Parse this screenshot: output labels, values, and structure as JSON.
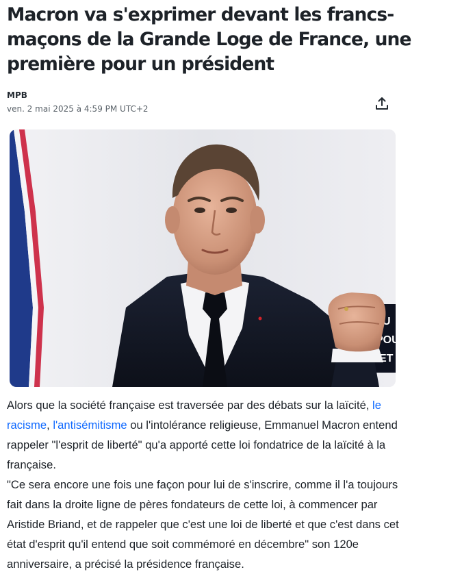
{
  "article": {
    "title": "Macron va s'exprimer devant les francs-maçons de la Grande Loge de France, une première pour un président",
    "author": "MPB",
    "timestamp": "ven. 2 mai 2025 à 4:59 PM UTC+2",
    "share_icon": "share-upload-icon",
    "image": {
      "subject": "photo-of-speaker-raising-fist",
      "backdrop_letters": [
        "U",
        "POU",
        "ET"
      ]
    },
    "paragraph1": {
      "before": "Alors que la société française est traversée par des débats sur la laïcité, ",
      "link1": "le racisme",
      "sep": ", ",
      "link2": "l'antisémitisme",
      "after": " ou l'intolérance religieuse, Emmanuel Macron entend rappeler \"l'esprit de liberté\" qu'a apporté cette loi fondatrice de la laïcité à la française."
    },
    "paragraph2": "\"Ce sera encore une fois une façon pour lui de s'inscrire, comme il l'a toujours fait dans la droite ligne de pères fondateurs de cette loi, à commencer par Aristide Briand, et de rappeler que c'est une loi de liberté et que c'est dans cet état d'esprit qu'il entend que soit commémoré en décembre\" son 120e anniversaire, a précisé la présidence française."
  },
  "colors": {
    "text": "#1d2228",
    "meta": "#5b636a",
    "link": "#0f69ff"
  }
}
